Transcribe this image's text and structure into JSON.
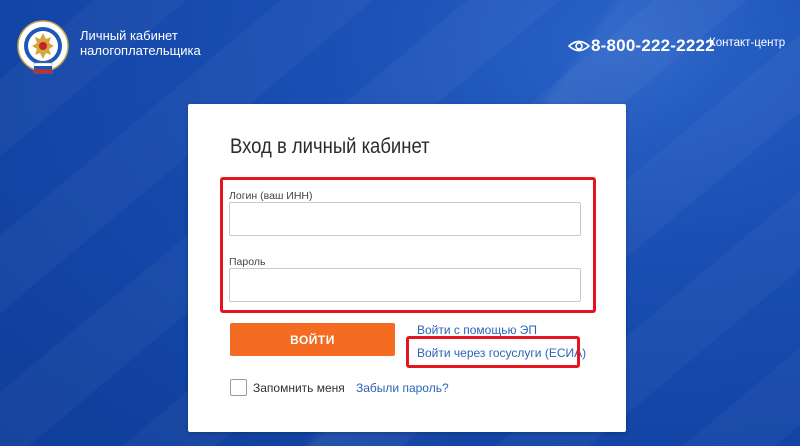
{
  "header": {
    "title_line1": "Личный кабинет",
    "title_line2": "налогоплательщика",
    "phone": "8-800-222-2222",
    "contact_center": "Контакт-центр",
    "logo_icon": "fns-emblem-icon",
    "phone_icon": "eye-icon"
  },
  "login_form": {
    "title": "Вход в личный кабинет",
    "login_label": "Логин (ваш ИНН)",
    "login_value": "",
    "password_label": "Пароль",
    "password_value": "",
    "submit_label": "ВОЙТИ",
    "ep_link": "Войти с помощью ЭП",
    "esia_link": "Войти через госуслуги (ЕСИА)",
    "remember_label": "Запомнить меня",
    "remember_checked": false,
    "forgot_link": "Забыли пароль?"
  },
  "colors": {
    "background": "#1346a8",
    "accent_button": "#f36c21",
    "link": "#2a64b9",
    "highlight": "#e4151f"
  }
}
